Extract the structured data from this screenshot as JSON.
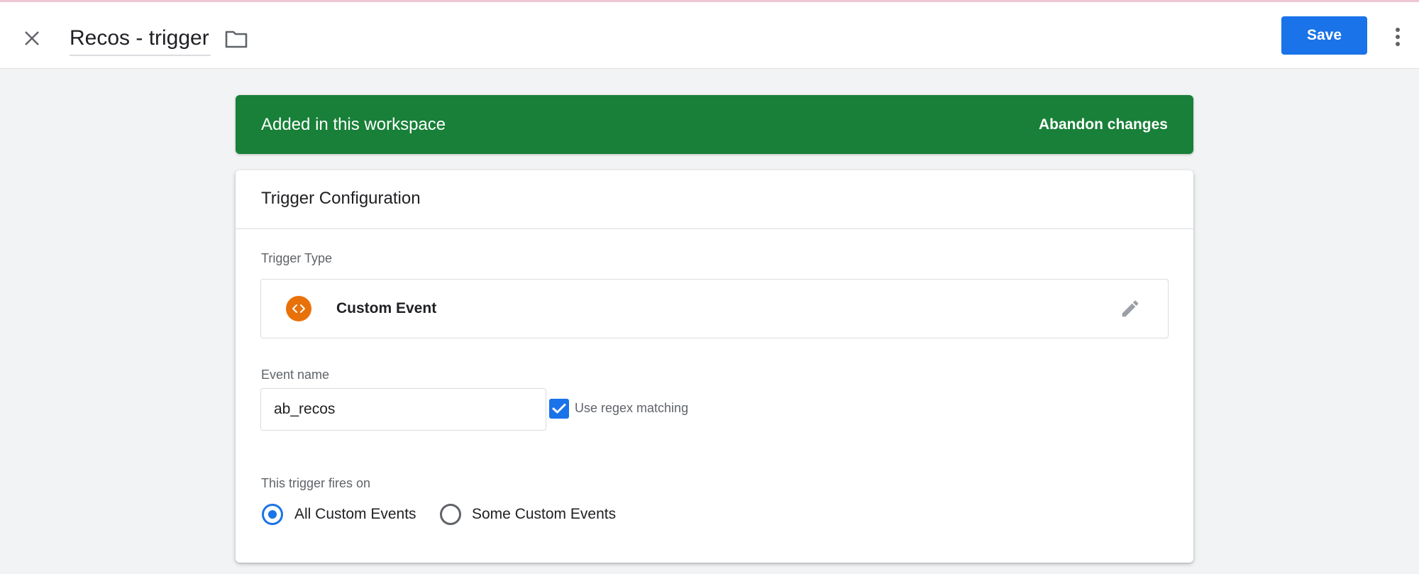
{
  "header": {
    "title": "Recos - trigger",
    "save_label": "Save"
  },
  "banner": {
    "message": "Added in this workspace",
    "action": "Abandon changes",
    "color": "#188038"
  },
  "card": {
    "title": "Trigger Configuration",
    "trigger_type_label": "Trigger Type",
    "trigger_type_name": "Custom Event",
    "trigger_type_icon": "code-brackets-icon",
    "event_name_label": "Event name",
    "event_name_value": "ab_recos",
    "regex_label": "Use regex matching",
    "regex_checked": true,
    "fires_on_label": "This trigger fires on",
    "fires_on_options": [
      {
        "label": "All Custom Events",
        "selected": true
      },
      {
        "label": "Some Custom Events",
        "selected": false
      }
    ]
  },
  "colors": {
    "accent": "#1a73e8",
    "trigger_icon": "#e8710a"
  }
}
